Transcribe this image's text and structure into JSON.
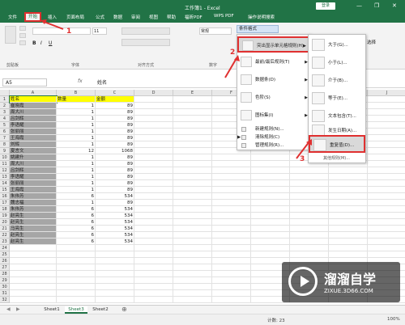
{
  "window": {
    "title": "工作簿1 - Excel",
    "login": "登录",
    "minimize": "—",
    "restore": "❐",
    "close": "✕"
  },
  "tabs": [
    "文件",
    "开始",
    "插入",
    "页面布局",
    "公式",
    "数据",
    "审阅",
    "视图",
    "帮助",
    "福昕PDF",
    "WPS PDF",
    "操作说明搜索"
  ],
  "ribbon": {
    "groups": [
      "剪贴板",
      "字体",
      "对齐方式",
      "数字"
    ],
    "font_size": "11",
    "number_format": "常规",
    "select_label": "选择",
    "cond_format": "条件格式"
  },
  "formula": {
    "cell": "A5",
    "fx": "fx",
    "value": "姓名"
  },
  "columns": [
    "A",
    "B",
    "C",
    "D",
    "E",
    "F",
    "G",
    "H",
    "I",
    "J",
    "K",
    "L",
    "M"
  ],
  "rows": [
    "1",
    "2",
    "3",
    "4",
    "5",
    "6",
    "7",
    "8",
    "9",
    "10",
    "11",
    "12",
    "13",
    "14",
    "15",
    "16",
    "17",
    "18",
    "19",
    "20",
    "21",
    "22",
    "23",
    "24",
    "25",
    "26",
    "27",
    "28",
    "29",
    "30",
    "31",
    "32"
  ],
  "table": [
    [
      "姓名",
      "数量",
      "金额"
    ],
    [
      "崔晓霞",
      "1",
      "89"
    ],
    [
      "周大川",
      "1",
      "89"
    ],
    [
      "吕剑辉",
      "1",
      "89"
    ],
    [
      "李语耀",
      "1",
      "89"
    ],
    [
      "张丽丽",
      "1",
      "89"
    ],
    [
      "王海霞",
      "1",
      "89"
    ],
    [
      "刘辉",
      "1",
      "89"
    ],
    [
      "夏言文",
      "12",
      "1068"
    ],
    [
      "姚建升",
      "1",
      "89"
    ],
    [
      "周大川",
      "1",
      "89"
    ],
    [
      "吕剑辉",
      "1",
      "89"
    ],
    [
      "李语耀",
      "1",
      "89"
    ],
    [
      "张丽丽",
      "1",
      "89"
    ],
    [
      "王海霞",
      "1",
      "89"
    ],
    [
      "朱伟芳",
      "6",
      "534"
    ],
    [
      "魏志福",
      "1",
      "89"
    ],
    [
      "朱伟芳",
      "6",
      "534"
    ],
    [
      "赵亮生",
      "6",
      "534"
    ],
    [
      "赵亮生",
      "6",
      "534"
    ],
    [
      "马亮生",
      "6",
      "534"
    ],
    [
      "赵亮生",
      "6",
      "534"
    ],
    [
      "赵亮生",
      "6",
      "534"
    ]
  ],
  "cf_menu": {
    "items": [
      "突出显示单元格规则(H)",
      "最前/最后规则(T)",
      "数据条(D)",
      "色阶(S)",
      "图标集(I)"
    ],
    "small": [
      "新建规则(N)...",
      "清除规则(C)",
      "管理规则(R)..."
    ]
  },
  "sub_menu": {
    "items": [
      "大于(G)...",
      "小于(L)...",
      "介于(B)...",
      "等于(E)...",
      "文本包含(T)...",
      "发生日期(A)...",
      "重复值(D)..."
    ],
    "more": "其他规则(M)..."
  },
  "annotations": [
    "1",
    "2",
    "3"
  ],
  "sheets": [
    "Sheet1",
    "Sheet3",
    "Sheet2"
  ],
  "status": {
    "count": "计数: 23",
    "zoom": "100%"
  },
  "watermark": {
    "title": "溜溜自学",
    "url": "ZIXUE.3D66.COM"
  },
  "colors": {
    "excel_green": "#217346",
    "header_yellow": "#ffff00",
    "selection_gray": "#a6a6a6",
    "highlight_red": "#e03030"
  }
}
